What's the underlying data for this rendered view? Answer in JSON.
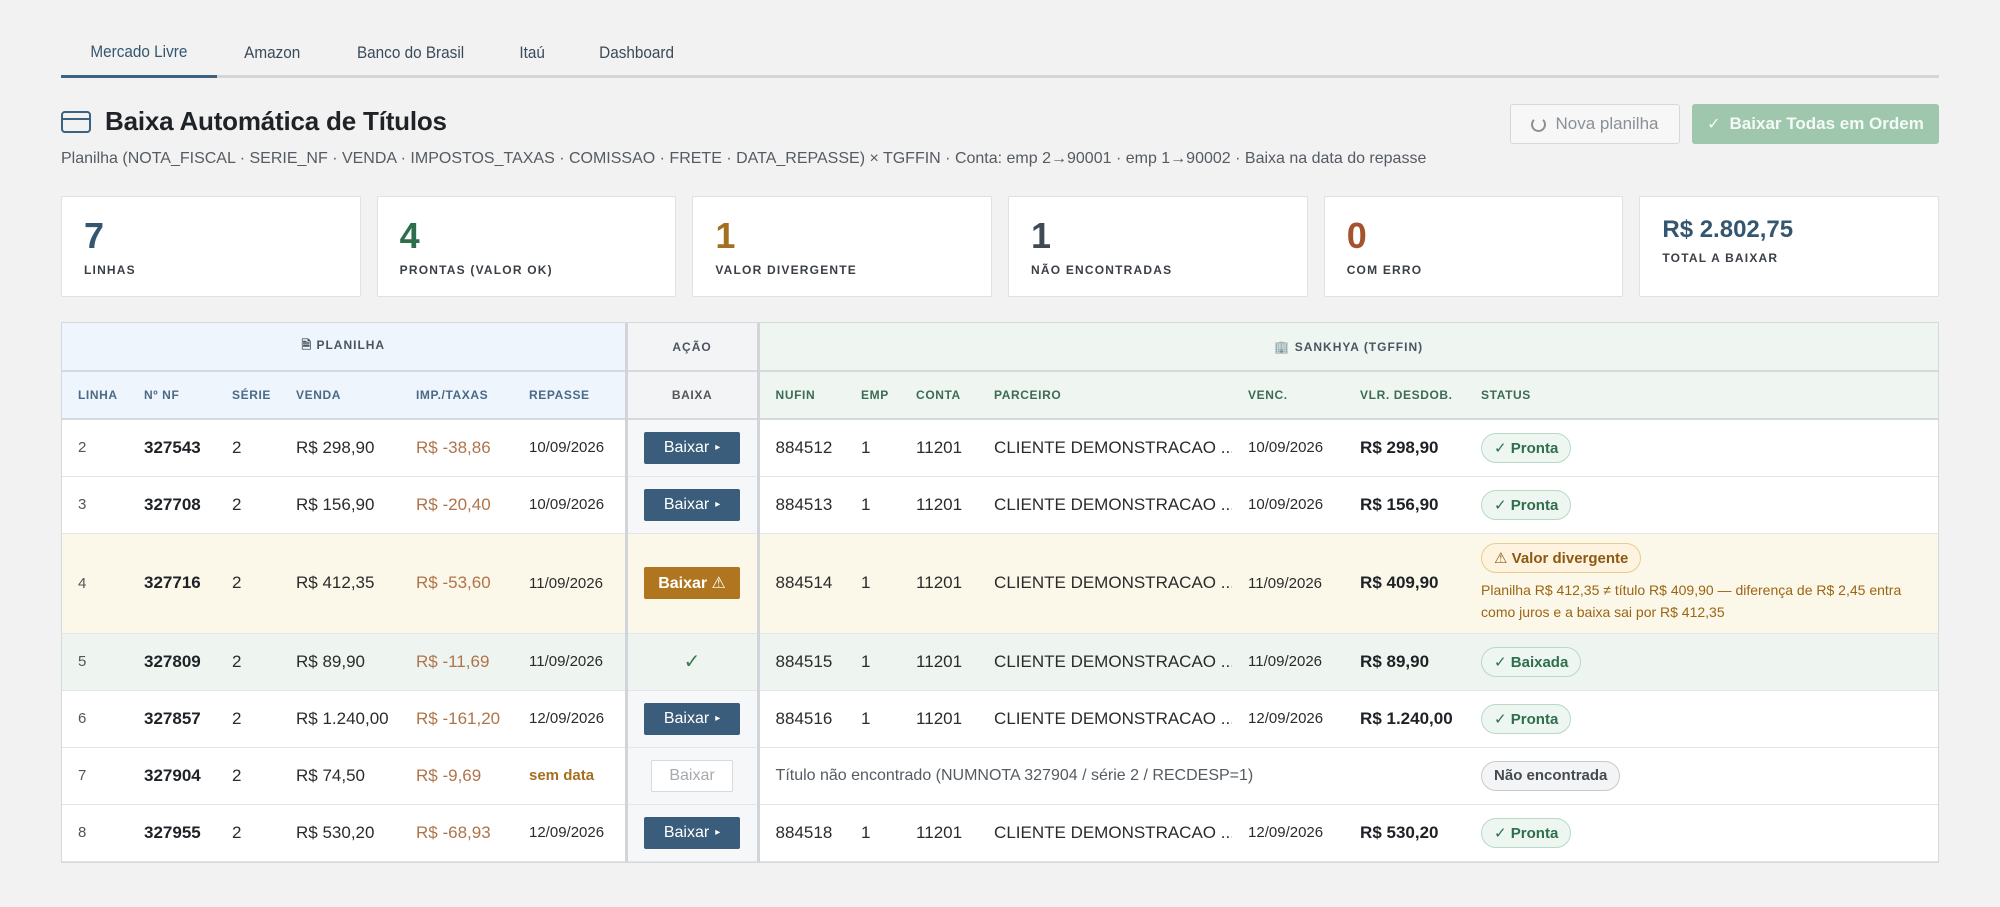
{
  "tabs": [
    "Mercado Livre",
    "Amazon",
    "Banco do Brasil",
    "Itaú",
    "Dashboard"
  ],
  "active_tab": 0,
  "header": {
    "title": "Baixa Automática de Títulos",
    "subtitle": "Planilha (NOTA_FISCAL · SERIE_NF · VENDA · IMPOSTOS_TAXAS · COMISSAO · FRETE · DATA_REPASSE) × TGFFIN · Conta: emp 2→90001 · emp 1→90002 · Baixa na data do repasse",
    "nova_planilha": "Nova planilha",
    "baixar_todas": "Baixar Todas em Ordem"
  },
  "stats": [
    {
      "value": "7",
      "label": "LINHAS",
      "color": "#35566f"
    },
    {
      "value": "4",
      "label": "PRONTAS (VALOR OK)",
      "color": "#2f6e4c"
    },
    {
      "value": "1",
      "label": "VALOR DIVERGENTE",
      "color": "#a56f1f"
    },
    {
      "value": "1",
      "label": "NÃO ENCONTRADAS",
      "color": "#3f4a55"
    },
    {
      "value": "0",
      "label": "COM ERRO",
      "color": "#a5532c"
    },
    {
      "value": "R$ 2.802,75",
      "label": "TOTAL A BAIXAR",
      "color": "#35566f"
    }
  ],
  "table": {
    "groups": {
      "planilha": "PLANILHA",
      "acao": "AÇÃO",
      "sankhya": "SANKHYA (TGFFIN)"
    },
    "columns": {
      "linha": "LINHA",
      "nf": "Nº NF",
      "serie": "SÉRIE",
      "venda": "VENDA",
      "imp": "IMP./TAXAS",
      "repasse": "REPASSE",
      "baixa": "BAIXA",
      "nufin": "NUFIN",
      "emp": "EMP",
      "conta": "CONTA",
      "parceiro": "PARCEIRO",
      "venc": "VENC.",
      "vlr": "VLR. DESDOB.",
      "status": "STATUS"
    },
    "rows": [
      {
        "linha": "2",
        "nf": "327543",
        "serie": "2",
        "venda": "R$ 298,90",
        "imp": "R$ -38,86",
        "repasse": "10/09/2026",
        "action": "Baixar",
        "action_type": "normal",
        "nufin": "884512",
        "emp": "1",
        "conta": "11201",
        "parceiro": "CLIENTE DEMONSTRACAO ...",
        "venc": "10/09/2026",
        "vlr": "R$ 298,90",
        "status": "✓ Pronta",
        "status_type": "ok"
      },
      {
        "linha": "3",
        "nf": "327708",
        "serie": "2",
        "venda": "R$ 156,90",
        "imp": "R$ -20,40",
        "repasse": "10/09/2026",
        "action": "Baixar",
        "action_type": "normal",
        "nufin": "884513",
        "emp": "1",
        "conta": "11201",
        "parceiro": "CLIENTE DEMONSTRACAO ...",
        "venc": "10/09/2026",
        "vlr": "R$ 156,90",
        "status": "✓ Pronta",
        "status_type": "ok"
      },
      {
        "linha": "4",
        "nf": "327716",
        "serie": "2",
        "venda": "R$ 412,35",
        "imp": "R$ -53,60",
        "repasse": "11/09/2026",
        "action": "Baixar ⚠",
        "action_type": "warn",
        "nufin": "884514",
        "emp": "1",
        "conta": "11201",
        "parceiro": "CLIENTE DEMONSTRACAO ...",
        "venc": "11/09/2026",
        "vlr": "R$ 409,90",
        "status": "⚠ Valor divergente",
        "status_type": "warn",
        "message": "Planilha R$ 412,35 ≠ título R$ 409,90 — diferença de R$ 2,45 entra como juros e a baixa sai por R$ 412,35"
      },
      {
        "linha": "5",
        "nf": "327809",
        "serie": "2",
        "venda": "R$ 89,90",
        "imp": "R$ -11,69",
        "repasse": "11/09/2026",
        "action": "✓",
        "action_type": "done",
        "nufin": "884515",
        "emp": "1",
        "conta": "11201",
        "parceiro": "CLIENTE DEMONSTRACAO ...",
        "venc": "11/09/2026",
        "vlr": "R$ 89,90",
        "status": "✓ Baixada",
        "status_type": "ok"
      },
      {
        "linha": "6",
        "nf": "327857",
        "serie": "2",
        "venda": "R$ 1.240,00",
        "imp": "R$ -161,20",
        "repasse": "12/09/2026",
        "action": "Baixar",
        "action_type": "normal",
        "nufin": "884516",
        "emp": "1",
        "conta": "11201",
        "parceiro": "CLIENTE DEMONSTRACAO ...",
        "venc": "12/09/2026",
        "vlr": "R$ 1.240,00",
        "status": "✓ Pronta",
        "status_type": "ok"
      },
      {
        "linha": "7",
        "nf": "327904",
        "serie": "2",
        "venda": "R$ 74,50",
        "imp": "R$ -9,69",
        "repasse": "sem data",
        "action": "Baixar",
        "action_type": "disabled",
        "missing": "Título não encontrado (NUMNOTA 327904 / série 2 / RECDESP=1)",
        "status": "Não encontrada",
        "status_type": "nf"
      },
      {
        "linha": "8",
        "nf": "327955",
        "serie": "2",
        "venda": "R$ 530,20",
        "imp": "R$ -68,93",
        "repasse": "12/09/2026",
        "action": "Baixar",
        "action_type": "normal",
        "nufin": "884518",
        "emp": "1",
        "conta": "11201",
        "parceiro": "CLIENTE DEMONSTRACAO ...",
        "venc": "12/09/2026",
        "vlr": "R$ 530,20",
        "status": "✓ Pronta",
        "status_type": "ok"
      }
    ]
  }
}
